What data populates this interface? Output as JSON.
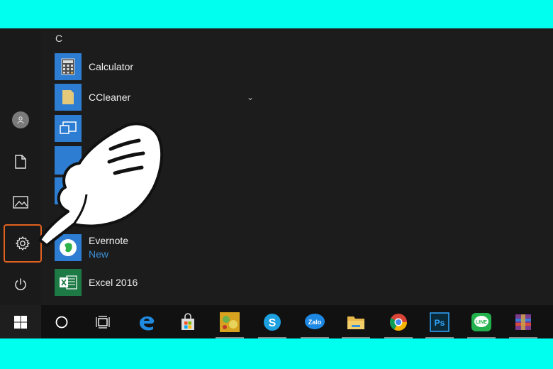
{
  "start_menu": {
    "letter_header": "C",
    "apps": [
      {
        "name": "Calculator",
        "sub": "",
        "tile_color": "#2d7dd2"
      },
      {
        "name": "CCleaner",
        "sub": "",
        "tile_color": "#2d7dd2"
      },
      {
        "name": "",
        "sub": "",
        "tile_color": "#2d7dd2"
      },
      {
        "name": "Evernote",
        "sub": "New",
        "tile_color": "#2d7dd2"
      },
      {
        "name": "Excel 2016",
        "sub": "",
        "tile_color": "#1d7a45"
      }
    ],
    "rail_icons": [
      "user-avatar-icon",
      "document-icon",
      "pictures-icon",
      "settings-icon",
      "power-icon"
    ]
  },
  "taskbar": {
    "icons": [
      "windows-start-icon",
      "search-circle-icon",
      "task-view-icon",
      "edge-icon",
      "store-icon",
      "photo-app-icon",
      "skype-icon",
      "zalo-icon",
      "file-explorer-icon",
      "chrome-icon",
      "photoshop-icon",
      "line-icon",
      "winrar-icon"
    ],
    "zalo_label": "Zalo",
    "photoshop_label": "Ps",
    "line_label": "LINE"
  },
  "colors": {
    "frame": "#00ffee",
    "highlight": "#e2611f",
    "accent": "#3a8fd8"
  }
}
